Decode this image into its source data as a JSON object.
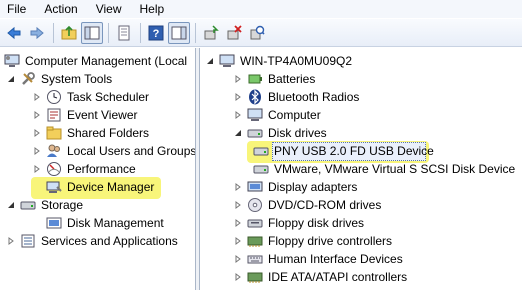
{
  "menubar": {
    "items": [
      "File",
      "Action",
      "View",
      "Help"
    ]
  },
  "left_tree": {
    "root": "Computer Management (Local",
    "system_tools": "System Tools",
    "task_scheduler": "Task Scheduler",
    "event_viewer": "Event Viewer",
    "shared_folders": "Shared Folders",
    "local_users": "Local Users and Groups",
    "performance": "Performance",
    "device_manager": "Device Manager",
    "storage": "Storage",
    "disk_management": "Disk Management",
    "services": "Services and Applications"
  },
  "right_tree": {
    "computer_name": "WIN-TP4A0MU09Q2",
    "batteries": "Batteries",
    "bluetooth": "Bluetooth Radios",
    "computer": "Computer",
    "disk_drives": "Disk drives",
    "pny_usb": "PNY USB 2.0 FD USB Device",
    "vmware_disk": "VMware, VMware Virtual S SCSI Disk Device",
    "display_adapters": "Display adapters",
    "dvd_rom": "DVD/CD-ROM drives",
    "floppy_disk": "Floppy disk drives",
    "floppy_ctrl": "Floppy drive controllers",
    "hid": "Human Interface Devices",
    "ide": "IDE ATA/ATAPI controllers"
  },
  "colors": {
    "highlight": "#f8f57a",
    "selection_border": "#5a78a8"
  }
}
